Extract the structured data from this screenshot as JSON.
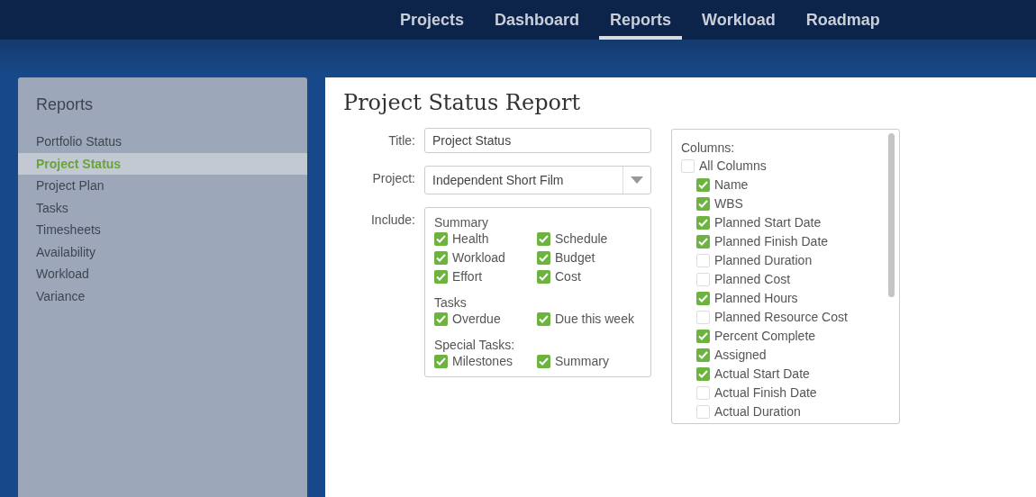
{
  "nav": [
    {
      "label": "Projects",
      "selected": false
    },
    {
      "label": "Dashboard",
      "selected": false
    },
    {
      "label": "Reports",
      "selected": true
    },
    {
      "label": "Workload",
      "selected": false
    },
    {
      "label": "Roadmap",
      "selected": false
    }
  ],
  "sidebar": {
    "title": "Reports",
    "items": [
      {
        "label": "Portfolio Status",
        "selected": false
      },
      {
        "label": "Project Status",
        "selected": true
      },
      {
        "label": "Project Plan",
        "selected": false
      },
      {
        "label": "Tasks",
        "selected": false
      },
      {
        "label": "Timesheets",
        "selected": false
      },
      {
        "label": "Availability",
        "selected": false
      },
      {
        "label": "Workload",
        "selected": false
      },
      {
        "label": "Variance",
        "selected": false
      }
    ]
  },
  "page_title": "Project Status Report",
  "form": {
    "title_label": "Title:",
    "title_value": "Project Status",
    "project_label": "Project:",
    "project_value": "Independent Short Film",
    "include_label": "Include:",
    "include_groups": [
      {
        "title": "Summary",
        "items": [
          {
            "label": "Health",
            "checked": true
          },
          {
            "label": "Schedule",
            "checked": true
          },
          {
            "label": "Workload",
            "checked": true
          },
          {
            "label": "Budget",
            "checked": true
          },
          {
            "label": "Effort",
            "checked": true
          },
          {
            "label": "Cost",
            "checked": true
          }
        ]
      },
      {
        "title": "Tasks",
        "items": [
          {
            "label": "Overdue",
            "checked": true
          },
          {
            "label": "Due this week",
            "checked": true
          }
        ]
      },
      {
        "title": "Special Tasks:",
        "items": [
          {
            "label": "Milestones",
            "checked": true
          },
          {
            "label": "Summary",
            "checked": true
          }
        ]
      }
    ]
  },
  "columns": {
    "title": "Columns:",
    "all": {
      "label": "All Columns",
      "checked": false
    },
    "items": [
      {
        "label": "Name",
        "checked": true
      },
      {
        "label": "WBS",
        "checked": true
      },
      {
        "label": "Planned Start Date",
        "checked": true
      },
      {
        "label": "Planned Finish Date",
        "checked": true
      },
      {
        "label": "Planned Duration",
        "checked": false
      },
      {
        "label": "Planned Cost",
        "checked": false
      },
      {
        "label": "Planned Hours",
        "checked": true
      },
      {
        "label": "Planned Resource Cost",
        "checked": false
      },
      {
        "label": "Percent Complete",
        "checked": true
      },
      {
        "label": "Assigned",
        "checked": true
      },
      {
        "label": "Actual Start Date",
        "checked": true
      },
      {
        "label": "Actual Finish Date",
        "checked": false
      },
      {
        "label": "Actual Duration",
        "checked": false
      }
    ]
  }
}
